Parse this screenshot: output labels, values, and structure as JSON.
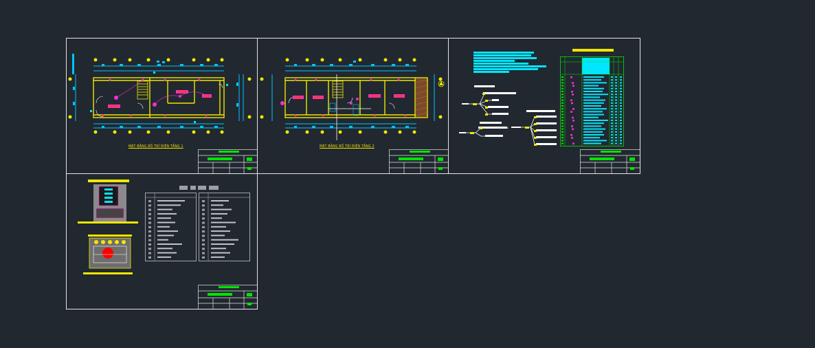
{
  "workspace": {
    "background_color": "#212830",
    "sheet_border_color": "#e6e6e6",
    "sheet_count": 4
  },
  "sheets": [
    {
      "id": "floor-plan-1",
      "caption": "MẶT BẰNG BỐ TRÍ ĐIỆN TẦNG 1"
    },
    {
      "id": "floor-plan-2",
      "caption": "MẶT BẰNG BỐ TRÍ ĐIỆN TẦNG 2"
    },
    {
      "id": "wiring-schedule",
      "caption": ""
    },
    {
      "id": "panel-legend",
      "caption": ""
    }
  ],
  "colors": {
    "dimension": "#00c6ff",
    "wall": "#f2e600",
    "device": "#ff2bd6",
    "title_block_accent": "#00e600",
    "panel_fill": "#ff0000",
    "table_border": "#9aa0a6"
  }
}
